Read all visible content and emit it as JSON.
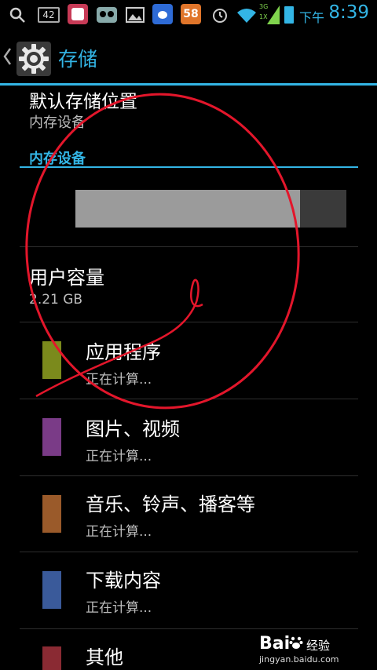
{
  "status_bar": {
    "ampm": "下午",
    "time": "8:39",
    "badge_42": "42",
    "badge_58": "58",
    "signal_tag_top": "3G",
    "signal_tag_bottom": "1X",
    "accent_color": "#33b5e5"
  },
  "action_bar": {
    "title": "存储",
    "icon": "gear-icon"
  },
  "default_location": {
    "title": "默认存储位置",
    "value": "内存设备"
  },
  "section": {
    "header": "内存设备"
  },
  "usage_bar": {
    "used_fraction": 0.83
  },
  "capacity": {
    "title": "用户容量",
    "value": "2.21 GB"
  },
  "categories": [
    {
      "title": "应用程序",
      "status": "正在计算...",
      "color": "#7b8a1c"
    },
    {
      "title": "图片、视频",
      "status": "正在计算...",
      "color": "#7a3b87"
    },
    {
      "title": "音乐、铃声、播客等",
      "status": "正在计算...",
      "color": "#9a5a2a"
    },
    {
      "title": "下载内容",
      "status": "正在计算...",
      "color": "#3a5a9a"
    },
    {
      "title": "其他",
      "status": "",
      "color": "#8a2a33"
    }
  ],
  "watermark": {
    "brand": "Bai",
    "brand_cn": "经验",
    "url": "jingyan.baidu.com"
  }
}
